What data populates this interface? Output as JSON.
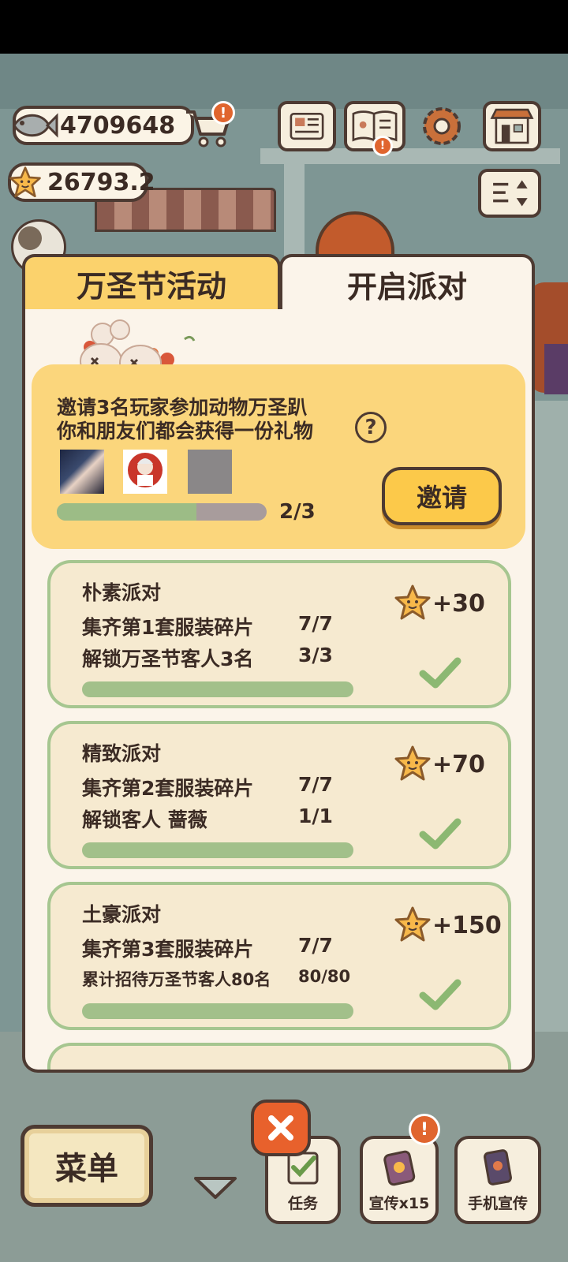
{
  "hud": {
    "fish_amount": "4709648",
    "star_amount": "26793.2",
    "cart_alert": "!"
  },
  "tabs": {
    "halloween": "万圣节活动",
    "party": "开启派对"
  },
  "invite": {
    "line1": "邀请3名玩家参加动物万圣趴",
    "line2": "你和朋友们都会获得一份礼物",
    "help": "?",
    "progress_text": "2/3",
    "progress": 0.667,
    "button": "邀请"
  },
  "tasks": [
    {
      "title": "朴素派对",
      "row1": "集齐第1套服装碎片",
      "row1_val": "7/7",
      "row2": "解锁万圣节客人3名",
      "row2_val": "3/3",
      "reward": "+30",
      "done": true
    },
    {
      "title": "精致派对",
      "row1": "集齐第2套服装碎片",
      "row1_val": "7/7",
      "row2": "解锁客人 蔷薇",
      "row2_val": "1/1",
      "reward": "+70",
      "done": true
    },
    {
      "title": "土豪派对",
      "row1": "集齐第3套服装碎片",
      "row1_val": "7/7",
      "row2": "累计招待万圣节客人80名",
      "row2_val": "80/80",
      "reward": "+150",
      "done": true
    }
  ],
  "bottom": {
    "menu": "菜单",
    "tasks": "任务",
    "promote": "宣传x15",
    "promote_alert": "!",
    "phone_promote": "手机宣传"
  },
  "colors": {
    "gold": "#fbd26c",
    "panel": "#fbf4ea",
    "green_border": "#a6c690",
    "close_orange": "#e8612c",
    "outline": "#4d3a32"
  }
}
